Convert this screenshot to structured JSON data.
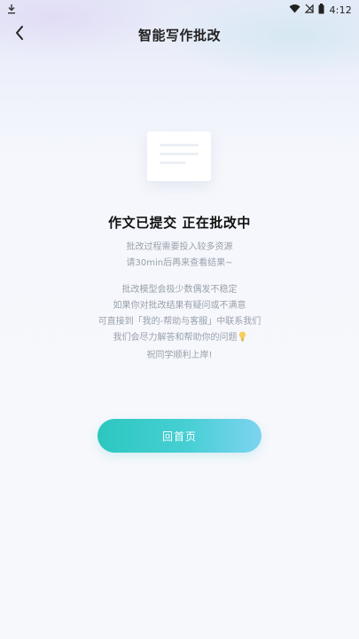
{
  "status_bar": {
    "time": "4:12",
    "icons": [
      "download-icon",
      "wifi-icon",
      "no-sim-icon",
      "battery-icon"
    ]
  },
  "nav": {
    "title": "智能写作批改",
    "back_icon": "chevron-left-icon"
  },
  "illustration": {
    "icon": "document-icon"
  },
  "content": {
    "headline": "作文已提交 正在批改中",
    "desc1": [
      "批改过程需要投入较多资源",
      "请30min后再来查看结果~"
    ],
    "desc2": [
      "批改模型会极少数偶发不稳定",
      "如果你对批改结果有疑问或不满意",
      "可直接到「我的-帮助与客服」中联系我们",
      "我们会尽力解答和帮助你的问题",
      "祝同学顺利上岸!"
    ],
    "bulb_icon": "lightbulb-icon"
  },
  "actions": {
    "home_label": "回首页"
  },
  "colors": {
    "accent_start": "#2cc7bf",
    "accent_end": "#7ed3f0",
    "title_text": "#222222",
    "muted_text": "#9aa0ab"
  }
}
